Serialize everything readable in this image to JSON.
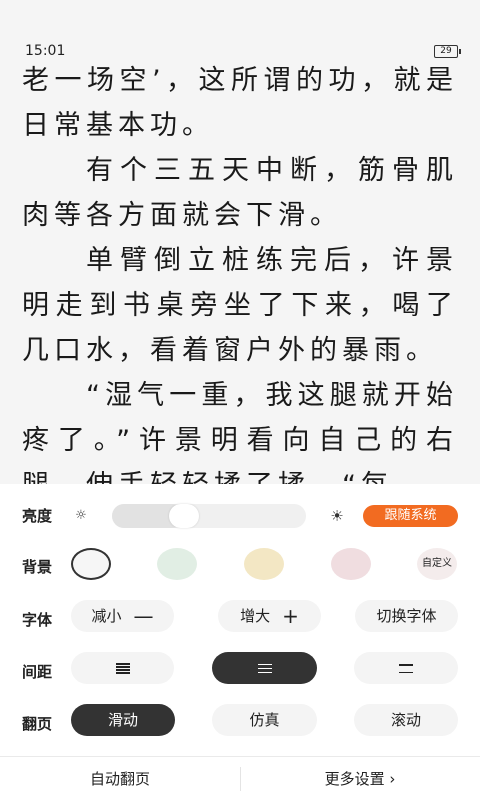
{
  "status_bar": {
    "time": "15:01",
    "battery": "29"
  },
  "reader": {
    "paragraphs": [
      {
        "text": "老一场空’，这所谓的功，就是日常基本功。",
        "indent": false
      },
      {
        "text": "有个三五天中断，筋骨肌肉等各方面就会下滑。",
        "indent": true
      },
      {
        "text": "单臂倒立桩练完后，许景明走到书桌旁坐了下来，喝了几口水，看着窗户外的暴雨。",
        "indent": true
      },
      {
        "text": "“湿气一重，我这腿就开始疼了。”许景明看向自己的右腿，伸手轻轻揉了揉。“每",
        "indent": false
      }
    ]
  },
  "settings": {
    "brightness": {
      "label": "亮度",
      "level": 0.35,
      "follow_system_label": "跟随系统"
    },
    "background": {
      "label": "背景",
      "swatches": [
        {
          "name": "white",
          "color": "#f6f6f6",
          "selected": true
        },
        {
          "name": "green",
          "color": "#e1eee4",
          "selected": false
        },
        {
          "name": "yellow",
          "color": "#f3e7c4",
          "selected": false
        },
        {
          "name": "pink",
          "color": "#f0dde0",
          "selected": false
        }
      ],
      "custom_label": "自定义"
    },
    "font": {
      "label": "字体",
      "decrease_label": "减小",
      "increase_label": "增大",
      "switch_label": "切换字体"
    },
    "spacing": {
      "label": "间距",
      "options": [
        "compact",
        "medium",
        "loose"
      ],
      "selected": "medium"
    },
    "page_turn": {
      "label": "翻页",
      "options": [
        "滑动",
        "仿真",
        "滚动"
      ],
      "selected": "滑动"
    }
  },
  "bottom_bar": {
    "auto_page_label": "自动翻页",
    "more_settings_label": "更多设置 ›"
  },
  "colors": {
    "accent": "#f26b21",
    "selected_pill": "#333333",
    "pill_bg": "#f4f4f4"
  }
}
